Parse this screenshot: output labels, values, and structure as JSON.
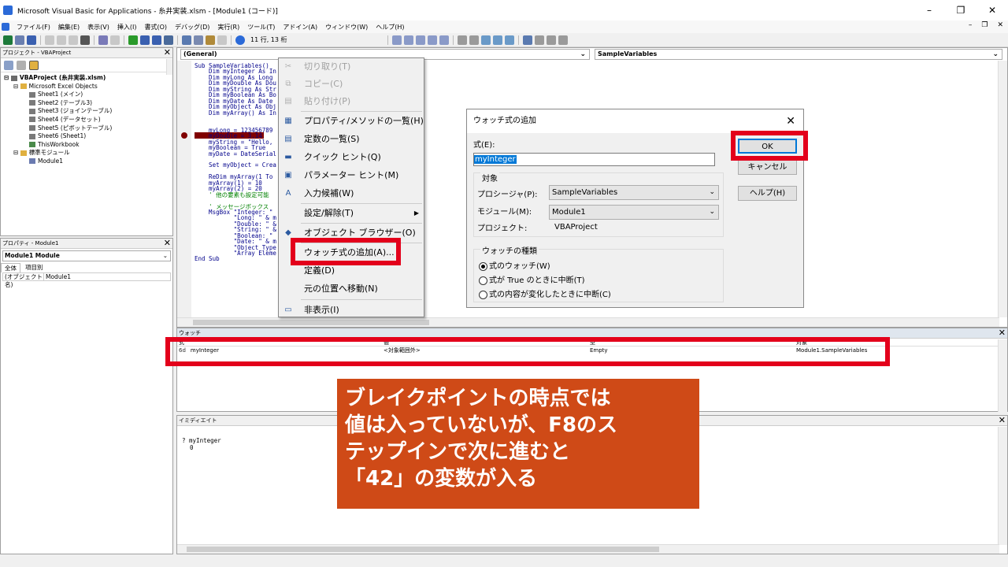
{
  "window": {
    "title": "Microsoft Visual Basic for Applications - 糸井実装.xlsm - [Module1 (コード)]"
  },
  "menu": [
    "ファイル(F)",
    "編集(E)",
    "表示(V)",
    "挿入(I)",
    "書式(O)",
    "デバッグ(D)",
    "実行(R)",
    "ツール(T)",
    "アドイン(A)",
    "ウィンドウ(W)",
    "ヘルプ(H)"
  ],
  "toolbar": {
    "position": "11 行, 13 桁"
  },
  "project": {
    "title": "プロジェクト - VBAProject",
    "tree": [
      "VBAProject (糸井実装.xlsm)",
      "Microsoft Excel Objects",
      "Sheet1 (メイン)",
      "Sheet2 (テーブル3)",
      "Sheet3 (ジョインテーブル)",
      "Sheet4 (データセット)",
      "Sheet5 (ピボットテーブル)",
      "Sheet6 (Sheet1)",
      "ThisWorkbook",
      "標準モジュール",
      "Module1"
    ]
  },
  "properties": {
    "title": "プロパティ - Module1",
    "object": "Module1 Module",
    "tabs": [
      "全体",
      "項目別"
    ],
    "row": "(オブジェクト名)",
    "value": "Module1"
  },
  "editor": {
    "object_combo": "(General)",
    "proc_combo": "SampleVariables",
    "lines": [
      "Sub SampleVariables()",
      "    Dim myInteger As In",
      "    Dim myLong As Long",
      "    Dim myDouble As Dou",
      "    Dim myString As Str",
      "    Dim myBoolean As Bo",
      "    Dim myDate As Date",
      "    Dim myObject As Obj",
      "    Dim myArray() As In",
      "",
      "    myInteger = 42",
      "    myLong = 123456789",
      "    myDouble = 3.14",
      "    myString = \"Hello,",
      "    myBoolean = True",
      "    myDate = DateSerial",
      "",
      "    Set myObject = Crea",
      "",
      "    ReDim myArray(1 To",
      "    myArray(1) = 10",
      "    myArray(2) = 20",
      "    ' 他の要素も設定可能",
      "",
      "    ' メッセージボックス",
      "    MsgBox \"Integer: \"",
      "           \"Long: \" & m",
      "           \"Double: \" &",
      "           \"String: \" &",
      "           \"Boolean: \"",
      "           \"Date: \" & m",
      "           \"Object Type",
      "           \"Array Eleme",
      "End Sub"
    ]
  },
  "context_menu": [
    {
      "label": "切り取り(T)",
      "icon": "cut-icon",
      "disabled": true
    },
    {
      "label": "コピー(C)",
      "icon": "copy-icon",
      "disabled": true
    },
    {
      "label": "貼り付け(P)",
      "icon": "paste-icon",
      "disabled": true
    },
    {
      "label": "プロパティ/メソッドの一覧(H)",
      "icon": "list-icon",
      "disabled": false
    },
    {
      "label": "定数の一覧(S)",
      "icon": "constants-icon",
      "disabled": false
    },
    {
      "label": "クイック ヒント(Q)",
      "icon": "quickinfo-icon",
      "disabled": false
    },
    {
      "label": "パラメーター ヒント(M)",
      "icon": "param-icon",
      "disabled": false
    },
    {
      "label": "入力候補(W)",
      "icon": "complete-icon",
      "disabled": false
    },
    {
      "label": "設定/解除(T)",
      "icon": "",
      "disabled": false
    },
    {
      "label": "オブジェクト ブラウザー(O)",
      "icon": "browser-icon",
      "disabled": false
    },
    {
      "label": "ウォッチ式の追加(A)...",
      "icon": "",
      "disabled": false
    },
    {
      "label": "定義(D)",
      "icon": "",
      "disabled": false
    },
    {
      "label": "元の位置へ移動(N)",
      "icon": "",
      "disabled": false
    },
    {
      "label": "非表示(I)",
      "icon": "hide-icon",
      "disabled": false
    }
  ],
  "dialog": {
    "title": "ウォッチ式の追加",
    "expr_label": "式(E):",
    "expr_value": "myInteger",
    "target_group": "対象",
    "proc_label": "プロシージャ(P):",
    "proc_value": "SampleVariables",
    "module_label": "モジュール(M):",
    "module_value": "Module1",
    "project_label": "プロジェクト:",
    "project_value": "VBAProject",
    "kind_group": "ウォッチの種類",
    "radios": [
      "式のウォッチ(W)",
      "式が True のときに中断(T)",
      "式の内容が変化したときに中断(C)"
    ],
    "ok": "OK",
    "cancel": "キャンセル",
    "help": "ヘルプ(H)"
  },
  "watch": {
    "title": "ウォッチ",
    "cols": [
      "式",
      "値",
      "型",
      "対象"
    ],
    "row": [
      "myInteger",
      "<対象範囲外>",
      "Empty",
      "Module1.SampleVariables"
    ]
  },
  "immediate": {
    "title": "イミディエイト",
    "line1": "? myInteger",
    "line2": "0"
  },
  "note": [
    "ブレイクポイントの時点では",
    "値は入っていないが、F8のス",
    "テップインで次に進むと",
    "「42」の変数が入る"
  ]
}
